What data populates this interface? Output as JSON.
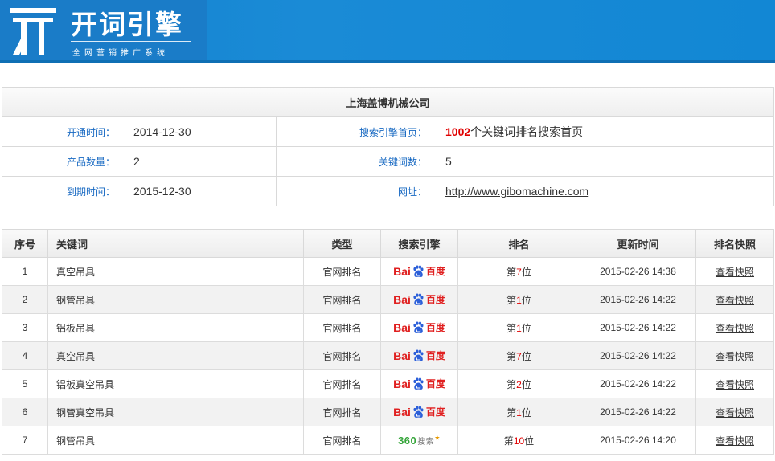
{
  "brand": {
    "title": "开词引擎",
    "subtitle": "全网营销推广系统",
    "colors": {
      "header": "#1a8bd6",
      "label": "#1668c2",
      "highlight": "#e00000"
    }
  },
  "company": {
    "name": "上海盖博机械公司",
    "open_label": "开通时间：",
    "open_date": "2014-12-30",
    "home_label": "搜索引擎首页：",
    "home_count": "1002",
    "home_suffix": "个关键词排名搜索首页",
    "products_label": "产品数量：",
    "products": "2",
    "keywords_label": "关键词数：",
    "keywords": "5",
    "expire_label": "到期时间：",
    "expire_date": "2015-12-30",
    "url_label": "网址：",
    "url": "http://www.gibomachine.com"
  },
  "table": {
    "headers": {
      "no": "序号",
      "keyword": "关键词",
      "type": "类型",
      "engine": "搜索引擎",
      "rank": "排名",
      "updated": "更新时间",
      "snapshot": "排名快照"
    },
    "rows": [
      {
        "no": "1",
        "keyword": "真空吊具",
        "type": "官网排名",
        "engine": "baidu",
        "rank_pre": "第",
        "rank": "7",
        "rank_post": "位",
        "updated": "2015-02-26 14:38",
        "snapshot": "查看快照"
      },
      {
        "no": "2",
        "keyword": "钢管吊具",
        "type": "官网排名",
        "engine": "baidu",
        "rank_pre": "第",
        "rank": "1",
        "rank_post": "位",
        "updated": "2015-02-26 14:22",
        "snapshot": "查看快照"
      },
      {
        "no": "3",
        "keyword": "铝板吊具",
        "type": "官网排名",
        "engine": "baidu",
        "rank_pre": "第",
        "rank": "1",
        "rank_post": "位",
        "updated": "2015-02-26 14:22",
        "snapshot": "查看快照"
      },
      {
        "no": "4",
        "keyword": "真空吊具",
        "type": "官网排名",
        "engine": "baidu",
        "rank_pre": "第",
        "rank": "7",
        "rank_post": "位",
        "updated": "2015-02-26 14:22",
        "snapshot": "查看快照"
      },
      {
        "no": "5",
        "keyword": "铝板真空吊具",
        "type": "官网排名",
        "engine": "baidu",
        "rank_pre": "第",
        "rank": "2",
        "rank_post": "位",
        "updated": "2015-02-26 14:22",
        "snapshot": "查看快照"
      },
      {
        "no": "6",
        "keyword": "钢管真空吊具",
        "type": "官网排名",
        "engine": "baidu",
        "rank_pre": "第",
        "rank": "1",
        "rank_post": "位",
        "updated": "2015-02-26 14:22",
        "snapshot": "查看快照"
      },
      {
        "no": "7",
        "keyword": "钢管吊具",
        "type": "官网排名",
        "engine": "360",
        "rank_pre": "第",
        "rank": "10",
        "rank_post": "位",
        "updated": "2015-02-26 14:20",
        "snapshot": "查看快照"
      }
    ],
    "engines": {
      "baidu": {
        "part1": "Bai",
        "part2": "百度",
        "icon": "baidu-paw-icon"
      },
      "360": {
        "part1": "360",
        "part2": "搜索",
        "icon": "360-search-logo"
      }
    }
  }
}
